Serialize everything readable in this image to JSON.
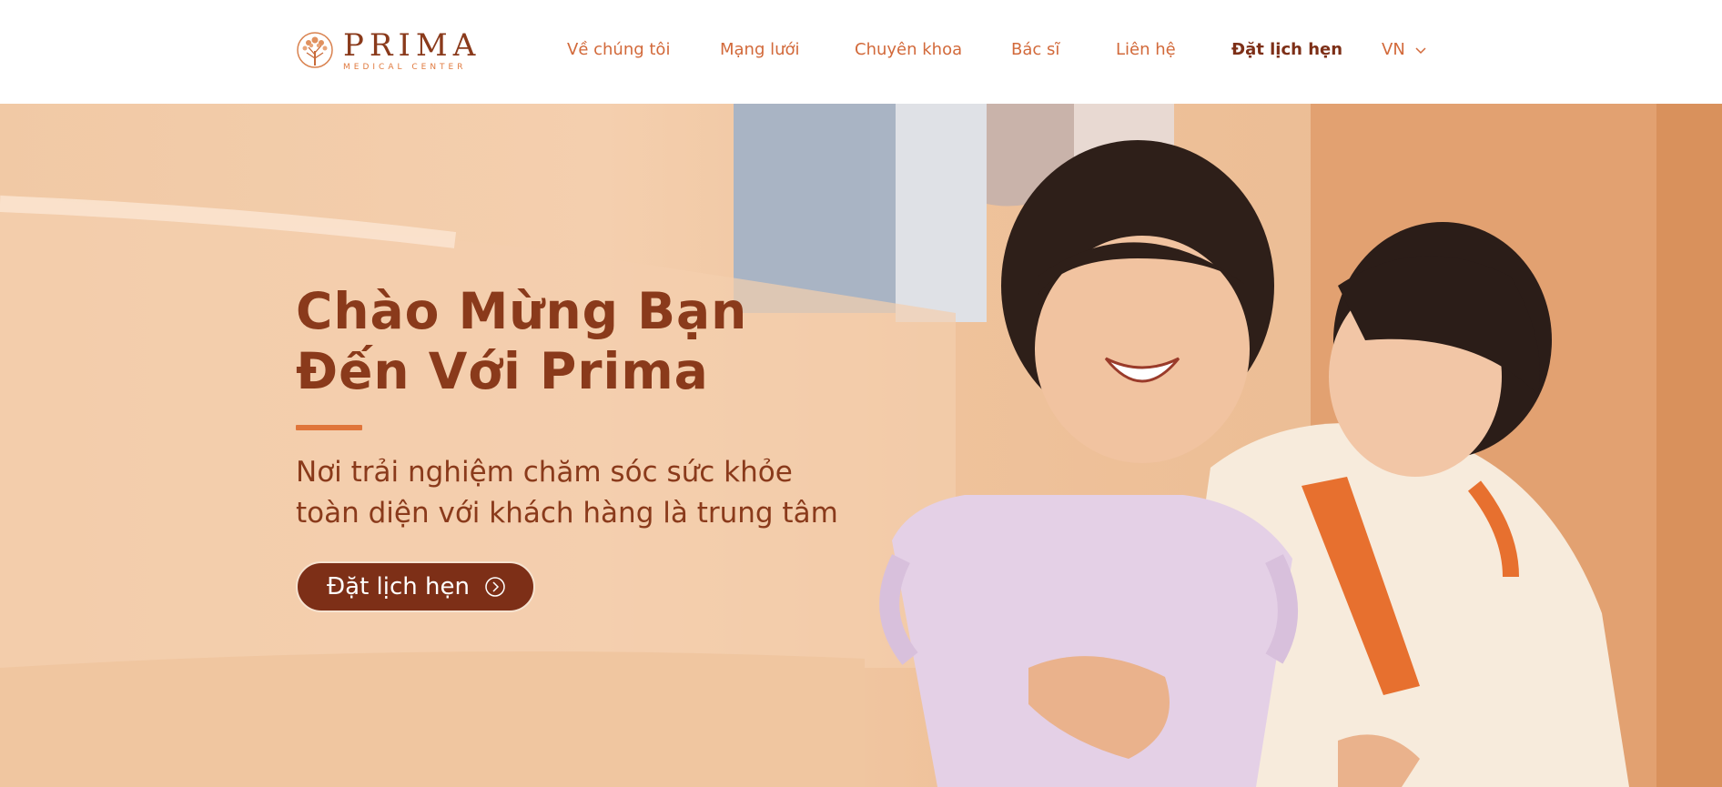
{
  "brand": {
    "name": "PRIMA",
    "tagline": "MEDICAL CENTER",
    "logo_icon": "tree-icon",
    "colors": {
      "primary": "#8a3a1b",
      "accent": "#e0753a",
      "nav": "#d2693a",
      "active": "#7d2f17"
    }
  },
  "nav": {
    "items": [
      {
        "label": "Về chúng tôi"
      },
      {
        "label": "Mạng lưới"
      },
      {
        "label": "Chuyên khoa"
      },
      {
        "label": "Bác sĩ"
      },
      {
        "label": "Liên hệ"
      },
      {
        "label": "Đặt lịch hẹn"
      }
    ],
    "language": "VN",
    "language_icon": "chevron-down-icon"
  },
  "hero": {
    "title_line1": "Chào Mừng Bạn",
    "title_line2": "Đến Với Prima",
    "subtitle_line1": "Nơi trải nghiệm chăm sóc sức khỏe",
    "subtitle_line2": "toàn diện với khách hàng là trung tâm",
    "cta_label": "Đặt lịch hẹn",
    "cta_icon": "arrow-circle-right-icon"
  }
}
